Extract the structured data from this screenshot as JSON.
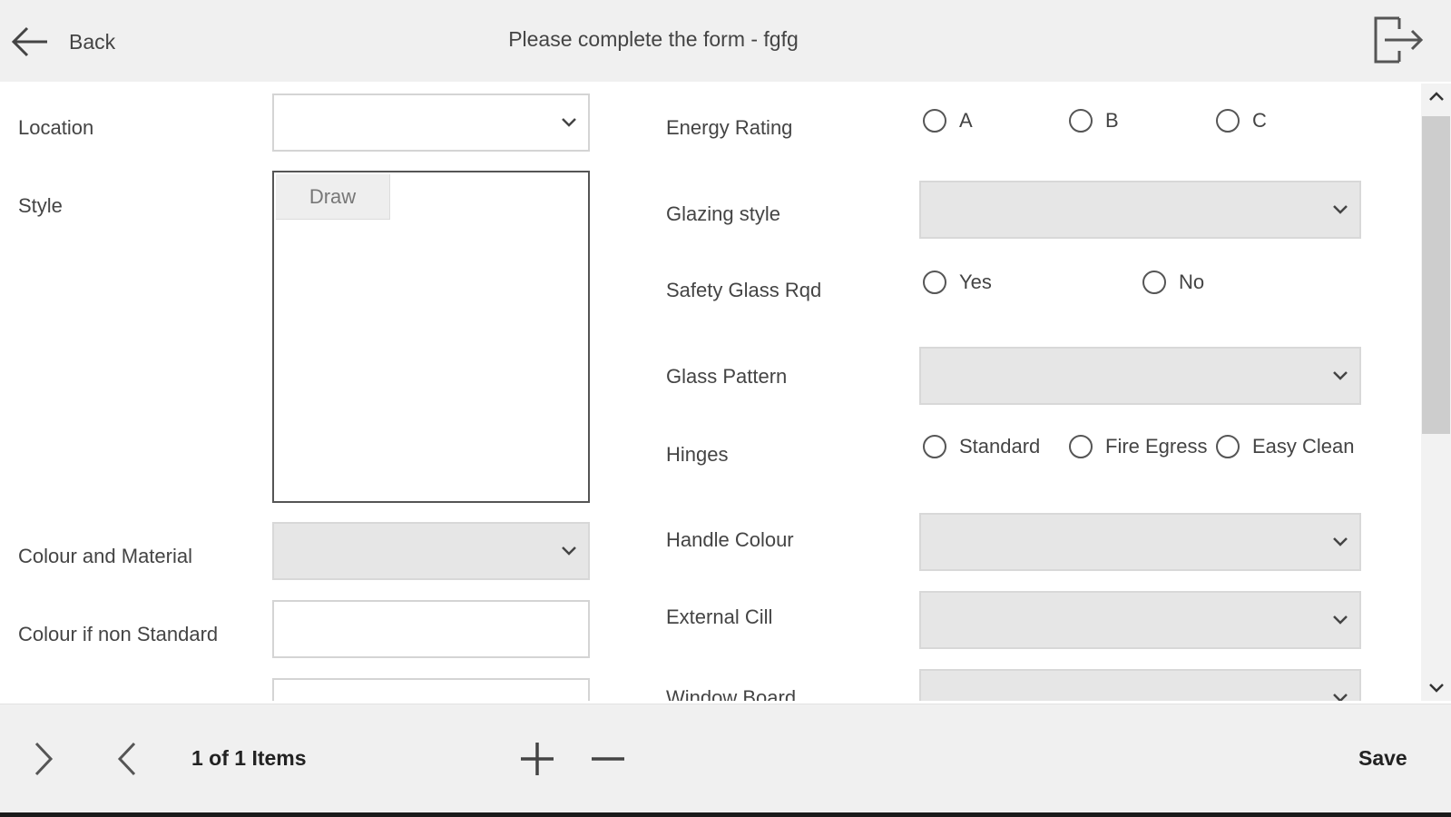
{
  "header": {
    "back_label": "Back",
    "title": "Please complete the form - fgfg",
    "logout_icon": "logout-icon"
  },
  "form": {
    "left": {
      "location_label": "Location",
      "style_label": "Style",
      "draw_label": "Draw",
      "colour_material_label": "Colour and Material",
      "colour_nonstd_label": "Colour if non Standard"
    },
    "right": {
      "energy_label": "Energy Rating",
      "energy_options": [
        "A",
        "B",
        "C"
      ],
      "glazing_label": "Glazing style",
      "safety_label": "Safety Glass Rqd",
      "safety_options": [
        "Yes",
        "No"
      ],
      "pattern_label": "Glass Pattern",
      "hinges_label": "Hinges",
      "hinges_options": [
        "Standard",
        "Fire Egress",
        "Easy Clean"
      ],
      "handle_label": "Handle Colour",
      "cill_label": "External Cill",
      "board_label": "Window Board"
    }
  },
  "footer": {
    "count_text": "1 of 1 Items",
    "save_label": "Save",
    "icons": [
      "chevron-right-icon",
      "chevron-left-icon",
      "plus-icon",
      "minus-icon"
    ]
  },
  "colors": {
    "bar_bg": "#f0f0f0",
    "field_grey": "#e6e6e6",
    "text": "#444444"
  }
}
